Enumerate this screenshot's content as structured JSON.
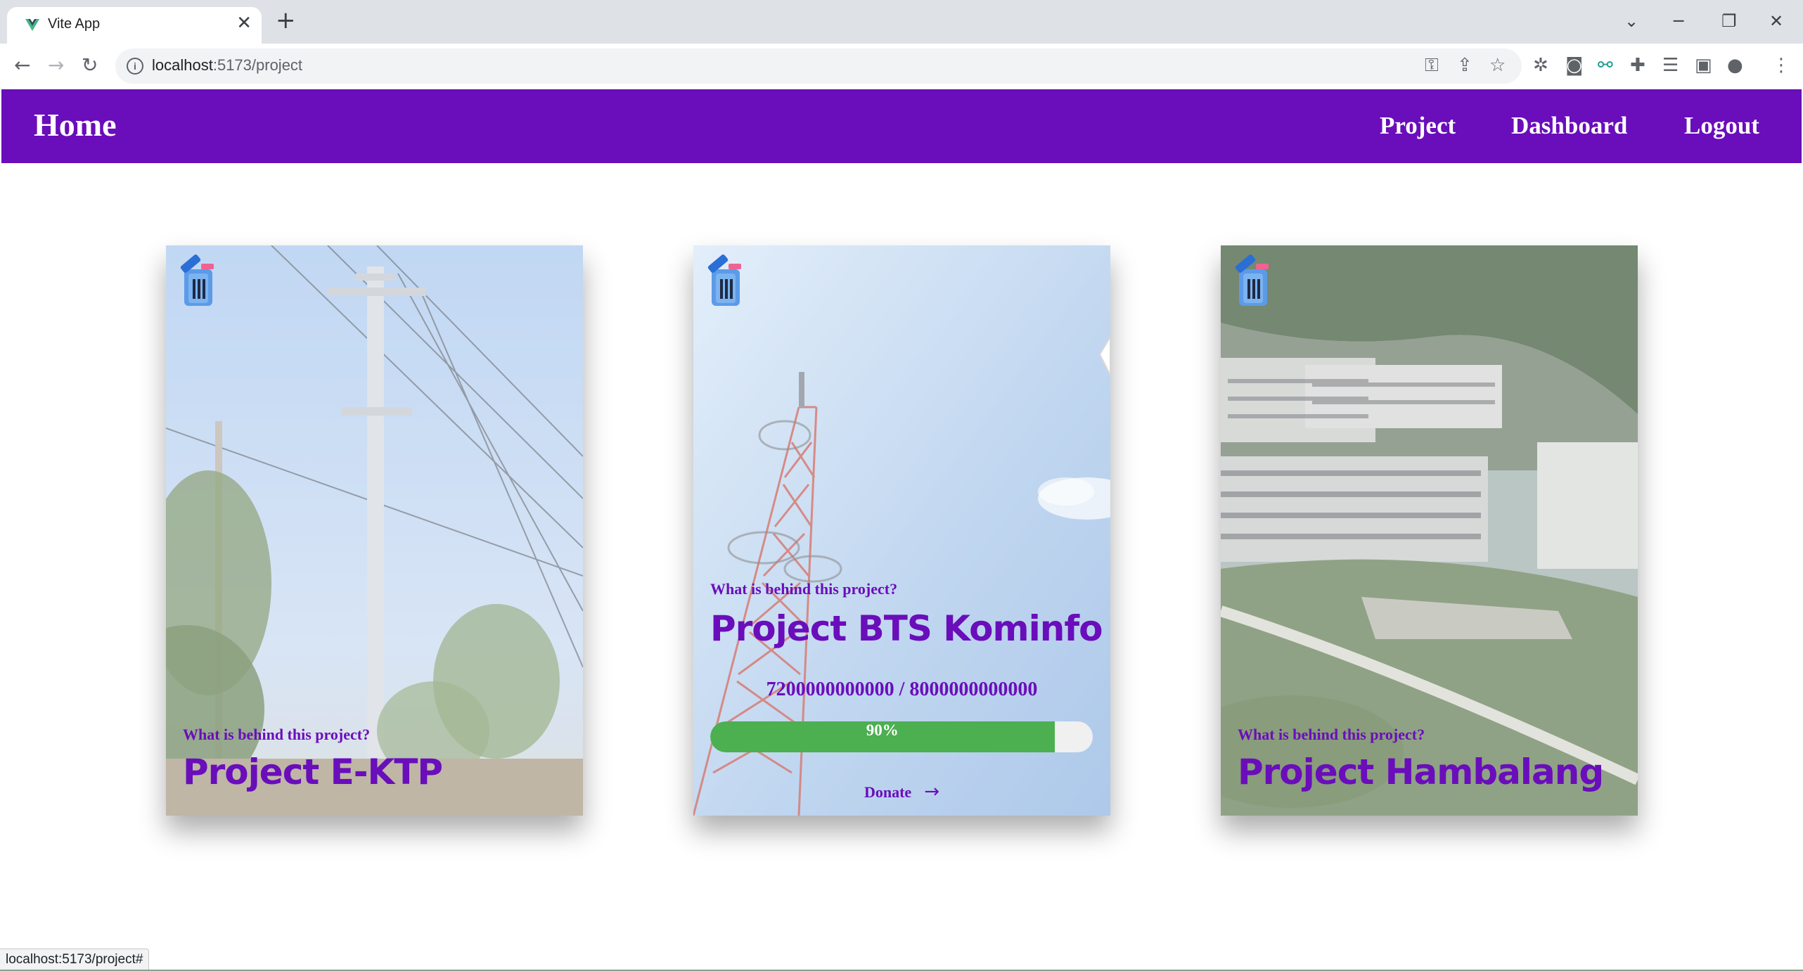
{
  "browser": {
    "tab_title": "Vite App",
    "tab_close": "✕",
    "new_tab": "+",
    "url_host": "localhost",
    "url_rest": ":5173/project",
    "status_url": "localhost:5173/project#"
  },
  "nav": {
    "brand": "Home",
    "links": [
      "Project",
      "Dashboard",
      "Logout"
    ]
  },
  "cards": [
    {
      "subtitle": "What is behind this project?",
      "title": "Project E-KTP",
      "image": "power-pole-photo"
    },
    {
      "subtitle": "What is behind this project?",
      "title": "Project BTS Kominfo",
      "amount": "7200000000000 / 8000000000000",
      "progress_fraction": 0.9,
      "progress_label": "90%",
      "donate_label": "Donate",
      "donate_arrow": "→",
      "image": "cell-tower-photo"
    },
    {
      "subtitle": "What is behind this project?",
      "title": "Project Hambalang",
      "image": "hillside-building-photo"
    }
  ],
  "colors": {
    "nav_bg": "#6a0dbb",
    "accent_text": "#6a0dbb",
    "progress_fill": "#4caf50",
    "progress_track": "#f0f0f0"
  }
}
